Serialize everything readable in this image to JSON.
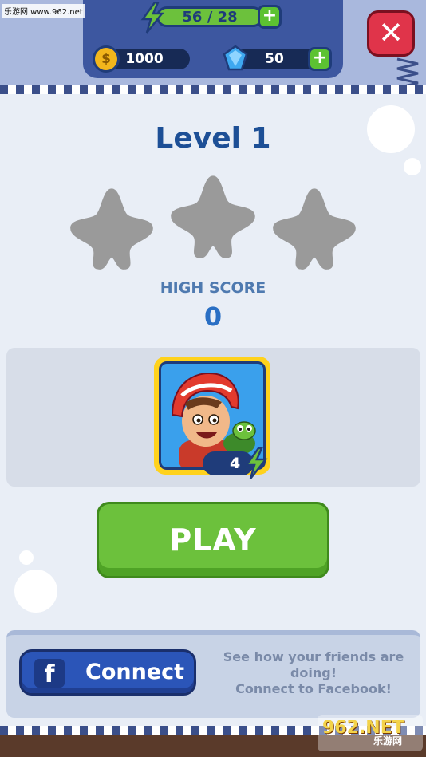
{
  "topbar": {
    "energy": "56 / 28",
    "coins": "1000",
    "gems": "50",
    "plus_label": "+",
    "close_label": "✕"
  },
  "level": {
    "title": "Level 1",
    "stars_earned": 0,
    "stars_total": 3,
    "high_score_label": "HIGH SCORE",
    "high_score_value": "0"
  },
  "booster": {
    "count": "4",
    "character": "helmet-boy-with-turtle"
  },
  "play": {
    "label": "PLAY"
  },
  "facebook": {
    "logo": "f",
    "button_label": "Connect",
    "note_line1": "See how your friends are doing!",
    "note_line2": "Connect to Facebook!"
  },
  "watermark": {
    "top_left": "乐游网 www.962.net",
    "bottom_right_logo": "962.NET",
    "bottom_right_text": "乐游网"
  },
  "colors": {
    "accent_green": "#6cc13c",
    "primary_blue": "#1d4f96",
    "close_red": "#e0344a",
    "facebook_blue": "#2b55b8",
    "star_empty": "#9a9a9a"
  }
}
